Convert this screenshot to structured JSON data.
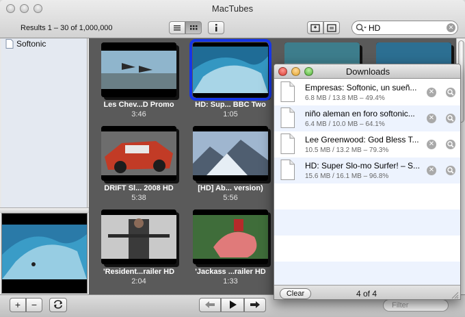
{
  "window": {
    "title": "MacTubes",
    "results_text": "Results 1 – 30 of 1,000,000"
  },
  "search": {
    "value": "HD",
    "placeholder": "Search"
  },
  "sidebar": {
    "items": [
      {
        "label": "Softonic"
      }
    ]
  },
  "videos": [
    {
      "title": "Les Chev...D Promo",
      "duration": "3:46"
    },
    {
      "title": "HD: Sup... BBC Two",
      "duration": "1:05"
    },
    {
      "title": "DRIFT Sl... 2008 HD",
      "duration": "5:38"
    },
    {
      "title": "[HD] Ab... version)",
      "duration": "5:56"
    },
    {
      "title": "'Resident...railer HD",
      "duration": "2:04"
    },
    {
      "title": "'Jackass ...railer HD",
      "duration": "1:33"
    }
  ],
  "downloads": {
    "title": "Downloads",
    "items": [
      {
        "name": "Empresas: Softonic, un sueñ...",
        "info": "6.8 MB / 13.8 MB – 49.4%",
        "progress": 0.494
      },
      {
        "name": "niño aleman en foro softonic...",
        "info": "6.4 MB / 10.0 MB – 64.1%",
        "progress": 0.641
      },
      {
        "name": "Lee Greenwood: God Bless T...",
        "info": "10.5 MB / 13.2 MB – 79.3%",
        "progress": 0.793
      },
      {
        "name": "HD: Super Slo-mo Surfer! – S...",
        "info": "15.6 MB / 16.1 MB – 96.8%",
        "progress": 0.968
      }
    ],
    "clear_label": "Clear",
    "count": "4 of 4"
  },
  "bottom": {
    "add_label": "+",
    "remove_label": "−",
    "filter_placeholder": "Filter"
  },
  "colors": {
    "selection": "#1636e6",
    "grid_bg": "#5a5a5a",
    "alt_row": "#edf3fe"
  }
}
